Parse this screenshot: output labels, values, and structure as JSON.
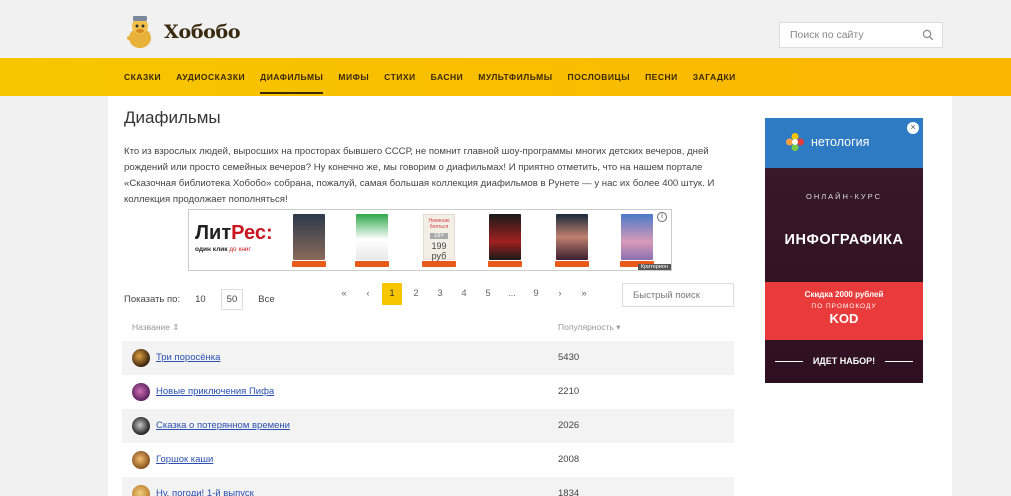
{
  "site": {
    "name": "Хобобо"
  },
  "search": {
    "placeholder": "Поиск по сайту"
  },
  "nav": [
    {
      "label": "СКАЗКИ",
      "active": false
    },
    {
      "label": "АУДИОСКАЗКИ",
      "active": false
    },
    {
      "label": "ДИАФИЛЬМЫ",
      "active": true
    },
    {
      "label": "МИФЫ",
      "active": false
    },
    {
      "label": "СТИХИ",
      "active": false
    },
    {
      "label": "БАСНИ",
      "active": false
    },
    {
      "label": "МУЛЬТФИЛЬМЫ",
      "active": false
    },
    {
      "label": "ПОСЛОВИЦЫ",
      "active": false
    },
    {
      "label": "ПЕСНИ",
      "active": false
    },
    {
      "label": "ЗАГАДКИ",
      "active": false
    }
  ],
  "page": {
    "title": "Диафильмы",
    "intro": "Кто из взрослых людей, выросших на просторах бывшего СССР, не помнит главной шоу-программы многих детских вечеров, дней рождений или просто семейных вечеров? Ну конечно же, мы говорим о диафильмах! И приятно отметить, что на нашем портале «Сказочная библиотека Хобобо» собрана, пожалуй, самая большая коллекция диафильмов в Рунете — у нас их более 400 штук. И коллекция продолжает пополняться!"
  },
  "ad_banner": {
    "logo_part1": "Лит",
    "logo_part2": "Рес:",
    "tagline_part1": "один клик",
    "tagline_part2": " до книг",
    "price_book_text": "Начинаю бояться",
    "price_book_age": "18+",
    "price": "199 руб",
    "info": "i",
    "credit": "Критерион"
  },
  "controls": {
    "show_label": "Показать по:",
    "show_options": [
      "10",
      "50",
      "Все"
    ],
    "show_selected": "50",
    "pagination": [
      "«",
      "‹",
      "1",
      "2",
      "3",
      "4",
      "5",
      "...",
      "9",
      "›",
      "»"
    ],
    "current_page": "1",
    "quick_search_placeholder": "Быстрый поиск"
  },
  "table": {
    "col_name": "Название ⇕",
    "col_popularity": "Популярность ▾",
    "rows": [
      {
        "title": "Три поросёнка",
        "popularity": "5430"
      },
      {
        "title": "Новые приключения Пифа",
        "popularity": "2210"
      },
      {
        "title": "Сказка о потерянном времени",
        "popularity": "2026"
      },
      {
        "title": "Горшок каши",
        "popularity": "2008"
      },
      {
        "title": "Ну, погоди! 1-й выпуск",
        "popularity": "1834"
      }
    ]
  },
  "side_ad": {
    "brand": "нетология",
    "course": "ОНЛАЙН-КУРС",
    "title": "ИНФОГРАФИКА",
    "discount": "Скидка 2000 рублей",
    "promo_label": "ПО ПРОМОКОДУ",
    "promo_code": "KOD",
    "cta": "ИДЕТ НАБОР!",
    "close": "×"
  },
  "colors": {
    "nav_yellow": "#f7c600",
    "link_blue": "#2a4fb0",
    "litres_red": "#c9161e",
    "netology_blue": "#2e7bc4",
    "promo_red": "#e93b3b"
  }
}
